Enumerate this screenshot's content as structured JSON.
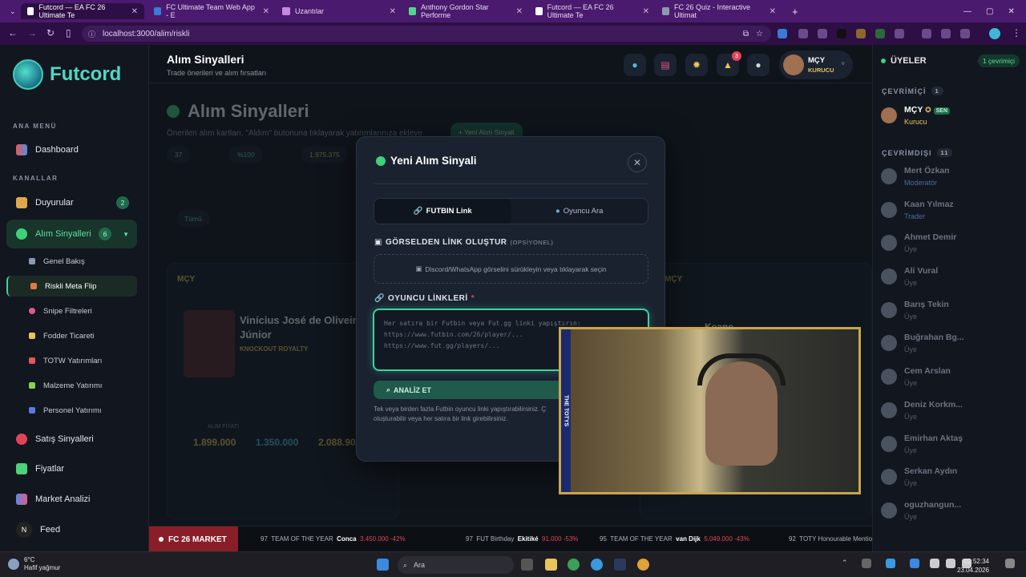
{
  "browser": {
    "tabs": [
      {
        "label": "Futcord — EA FC 26 Ultimate Te",
        "active": true
      },
      {
        "label": "FC Ultimate Team Web App - E",
        "active": false
      },
      {
        "label": "Uzantılar",
        "active": false
      },
      {
        "label": "Anthony Gordon Star Performe",
        "active": false
      },
      {
        "label": "Futcord — EA FC 26 Ultimate Te",
        "active": false
      },
      {
        "label": "FC 26 Quiz - Interactive Ultimat",
        "active": false
      }
    ],
    "url": "localhost:3000/alim/riskli"
  },
  "sidebar": {
    "brand": "Futcord",
    "section_main": "ANA MENÜ",
    "dashboard": "Dashboard",
    "section_channels": "KANALLAR",
    "announcements": {
      "label": "Duyurular",
      "count": "2"
    },
    "buy_signals": {
      "label": "Alım Sinyalleri",
      "count": "6"
    },
    "sub_items": [
      "Genel Bakış",
      "Riskli Meta Flip",
      "Snipe Filtreleri",
      "Fodder Ticareti",
      "TOTW Yatırımları",
      "Malzeme Yatırımı",
      "Personel Yatırımı"
    ],
    "sell_signals": "Satış Sinyalleri",
    "prices": "Fiyatlar",
    "market_analysis": "Market Analizi",
    "feed": "Feed"
  },
  "header": {
    "title": "Alım Sinyalleri",
    "subtitle": "Trade önerileri ve alım fırsatları",
    "notif_count": "3",
    "user_name": "MÇY",
    "user_role": "KURUCU"
  },
  "background": {
    "title": "Alım Sinyalleri",
    "desc": "Önerilen alım kartları, \"Aldım\" butonuna tıklayarak yatırımlarınıza ekleye",
    "new_button": "+ Yeni Alım Sinyali",
    "stats": [
      "37",
      "%100",
      "1.975.375"
    ],
    "filter_first": "Tümü",
    "card_player": "Vinícius José de Oliveira Júnior",
    "card_version": "KNOCKOUT ROYALTY",
    "card_buy_label": "ALIM FİYATI",
    "card_buy": "1.899.000",
    "card_now": "1.350.000",
    "card_target": "2.088.90",
    "card_author": "MÇY",
    "card_right_name": "Keane"
  },
  "modal": {
    "title": "Yeni Alım Sinyali",
    "tab_link": "FUTBIN Link",
    "tab_search": "Oyuncu Ara",
    "image_label": "GÖRSELDEN LİNK OLUŞTUR",
    "image_optional": "(OPSİYONEL)",
    "drop_text": "Discord/WhatsApp görselini sürükleyin veya tıklayarak seçin",
    "links_label": "OYUNCU LİNKLERİ",
    "links_placeholder": "Her satıra bir Futbin veya Fut.gg linki yapıştırın:\nhttps://www.futbin.com/26/player/...\nhttps://www.fut.gg/players/...",
    "analyze": "ANALİZ ET",
    "help": "Tek veya birden fazla Futbin oyuncu linki yapıştırabilirsiniz. Ç oluşturabilir veya her satıra bir link girebilirsiniz."
  },
  "ticker": {
    "label": "FC 26 MARKET",
    "items": [
      {
        "rating": "97",
        "promo": "TEAM OF THE YEAR",
        "name": "Conca",
        "price": "3.450.000 -42%"
      },
      {
        "rating": "97",
        "promo": "FUT Birthday",
        "name": "Ekitiké",
        "price": "91.000 -53%"
      },
      {
        "rating": "95",
        "promo": "TEAM OF THE YEAR",
        "name": "van Dijk",
        "price": "5.049.000 -43%"
      },
      {
        "rating": "92",
        "promo": "TOTY Honourable Mentio",
        "name": "",
        "price": ""
      }
    ]
  },
  "members": {
    "title": "ÜYELER",
    "online_pill": "1 çevrimiçi",
    "online_label": "ÇEVRİMİÇİ",
    "online_count": "1",
    "offline_label": "ÇEVRİMDIŞI",
    "offline_count": "11",
    "online": [
      {
        "name": "MÇY",
        "role": "Kurucu",
        "tag": "SEN"
      }
    ],
    "offline": [
      {
        "name": "Mert Özkan",
        "role": "Moderatör"
      },
      {
        "name": "Kaan Yılmaz",
        "role": "Trader"
      },
      {
        "name": "Ahmet Demir",
        "role": "Üye"
      },
      {
        "name": "Ali Vural",
        "role": "Üye"
      },
      {
        "name": "Barış Tekin",
        "role": "Üye"
      },
      {
        "name": "Buğrahan Bg...",
        "role": "Üye"
      },
      {
        "name": "Cem Arslan",
        "role": "Üye"
      },
      {
        "name": "Deniz Korkm...",
        "role": "Üye"
      },
      {
        "name": "Emirhan Aktaş",
        "role": "Üye"
      },
      {
        "name": "Serkan Aydın",
        "role": "Üye"
      },
      {
        "name": "oguzhangun...",
        "role": "Üye"
      }
    ]
  },
  "cam": {
    "strip": "THE TOTYS"
  },
  "taskbar": {
    "temp": "6°C",
    "weather": "Hafif yağmur",
    "search": "Ara",
    "time": "02:52:34",
    "date": "23.04.2026"
  },
  "colors": {
    "accent": "#3fd0a0",
    "brand": "#4fd8c4",
    "danger": "#e0445a",
    "gold": "#e8c45a"
  }
}
